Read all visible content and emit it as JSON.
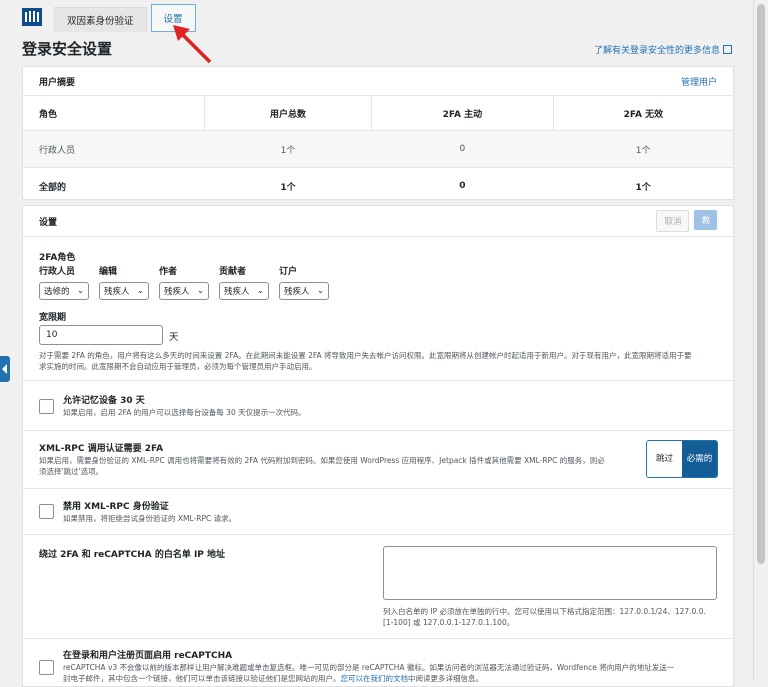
{
  "tabs": [
    {
      "label": "双因素身份验证"
    },
    {
      "label": "设置"
    }
  ],
  "page_title": "登录安全设置",
  "learn_more": "了解有关登录安全性的更多信息",
  "summary": {
    "title": "用户摘要",
    "manage": "管理用户",
    "columns": [
      "角色",
      "用户总数",
      "2FA 主动",
      "2FA 无效"
    ],
    "rows": [
      [
        "行政人员",
        "1个",
        "0",
        "1个"
      ],
      [
        "全部的",
        "1个",
        "0",
        "1个"
      ]
    ]
  },
  "settings": {
    "title": "设置",
    "cancel": "取消",
    "save": "救",
    "roles_label": "2FA角色",
    "roles": [
      {
        "name": "行政人员",
        "value": "选修的"
      },
      {
        "name": "编辑",
        "value": "残疾人"
      },
      {
        "name": "作者",
        "value": "残疾人"
      },
      {
        "name": "贡献者",
        "value": "残疾人"
      },
      {
        "name": "订户",
        "value": "残疾人"
      }
    ],
    "grace_label": "宽限期",
    "grace_value": "10",
    "grace_unit": "天",
    "grace_desc_1": "对于需要 2FA 的角色，用户将有这么多天的时间来设置 2FA。在此期间未能设置 2FA 将导致用户失去帐户访问权限。此宽限期将从创建帐户时起适用于新用户。对于现有用户，此宽限期将适用于要",
    "grace_desc_2": "求实施的时间。此宽限期不会自动应用于管理员，必须为每个管理员用户手动启用。",
    "remember_title": "允许记忆设备 30 天",
    "remember_desc": "如果启用，启用 2FA 的用户可以选择每台设备每 30 天仅提示一次代码。",
    "xmlrpc_title": "XML-RPC 调用认证需要 2FA",
    "xmlrpc_desc_1": "如果启用，需要身份验证的 XML-RPC 调用也将需要将有效的 2FA 代码附加到密码。如果您使用 WordPress 应用程序、Jetpack 插件或其他需要 XML-RPC 的服务，则必",
    "xmlrpc_desc_2": "须选择'跳过'选项。",
    "toggle_skip": "跳过",
    "toggle_required": "必需的",
    "disable_xmlrpc_title": "禁用 XML-RPC 身份验证",
    "disable_xmlrpc_desc": "如果禁用，将拒绝尝试身份验证的 XML-RPC 请求。",
    "whitelist_title": "绕过 2FA 和 reCAPTCHA 的白名单 IP 地址",
    "whitelist_desc_1": "列入白名单的 IP 必须放在单独的行中。您可以使用以下格式指定范围：127.0.0.1/24、127.0.0.",
    "whitelist_desc_2": "[1-100] 或 127.0.0.1-127.0.1.100。",
    "recaptcha_title": "在登录和用户注册页面启用 reCAPTCHA",
    "recaptcha_desc_1": "reCAPTCHA v3 不会像以前的版本那样让用户解决难题或单击复选框。唯一可见的部分是 reCAPTCHA 徽标。如果访问者的浏览器无法通过验证码，Wordfence 将向用户的地址发送一",
    "recaptcha_desc_2": "封电子邮件，其中包含一个链接，他们可以单击该链接以验证他们是您网站的用户。",
    "recaptcha_link": "您可以在我们的文档",
    "recaptcha_tail": "中阅读更多详细信息。"
  },
  "colors": {
    "accent": "#2271b1",
    "arrow": "#e02424"
  }
}
